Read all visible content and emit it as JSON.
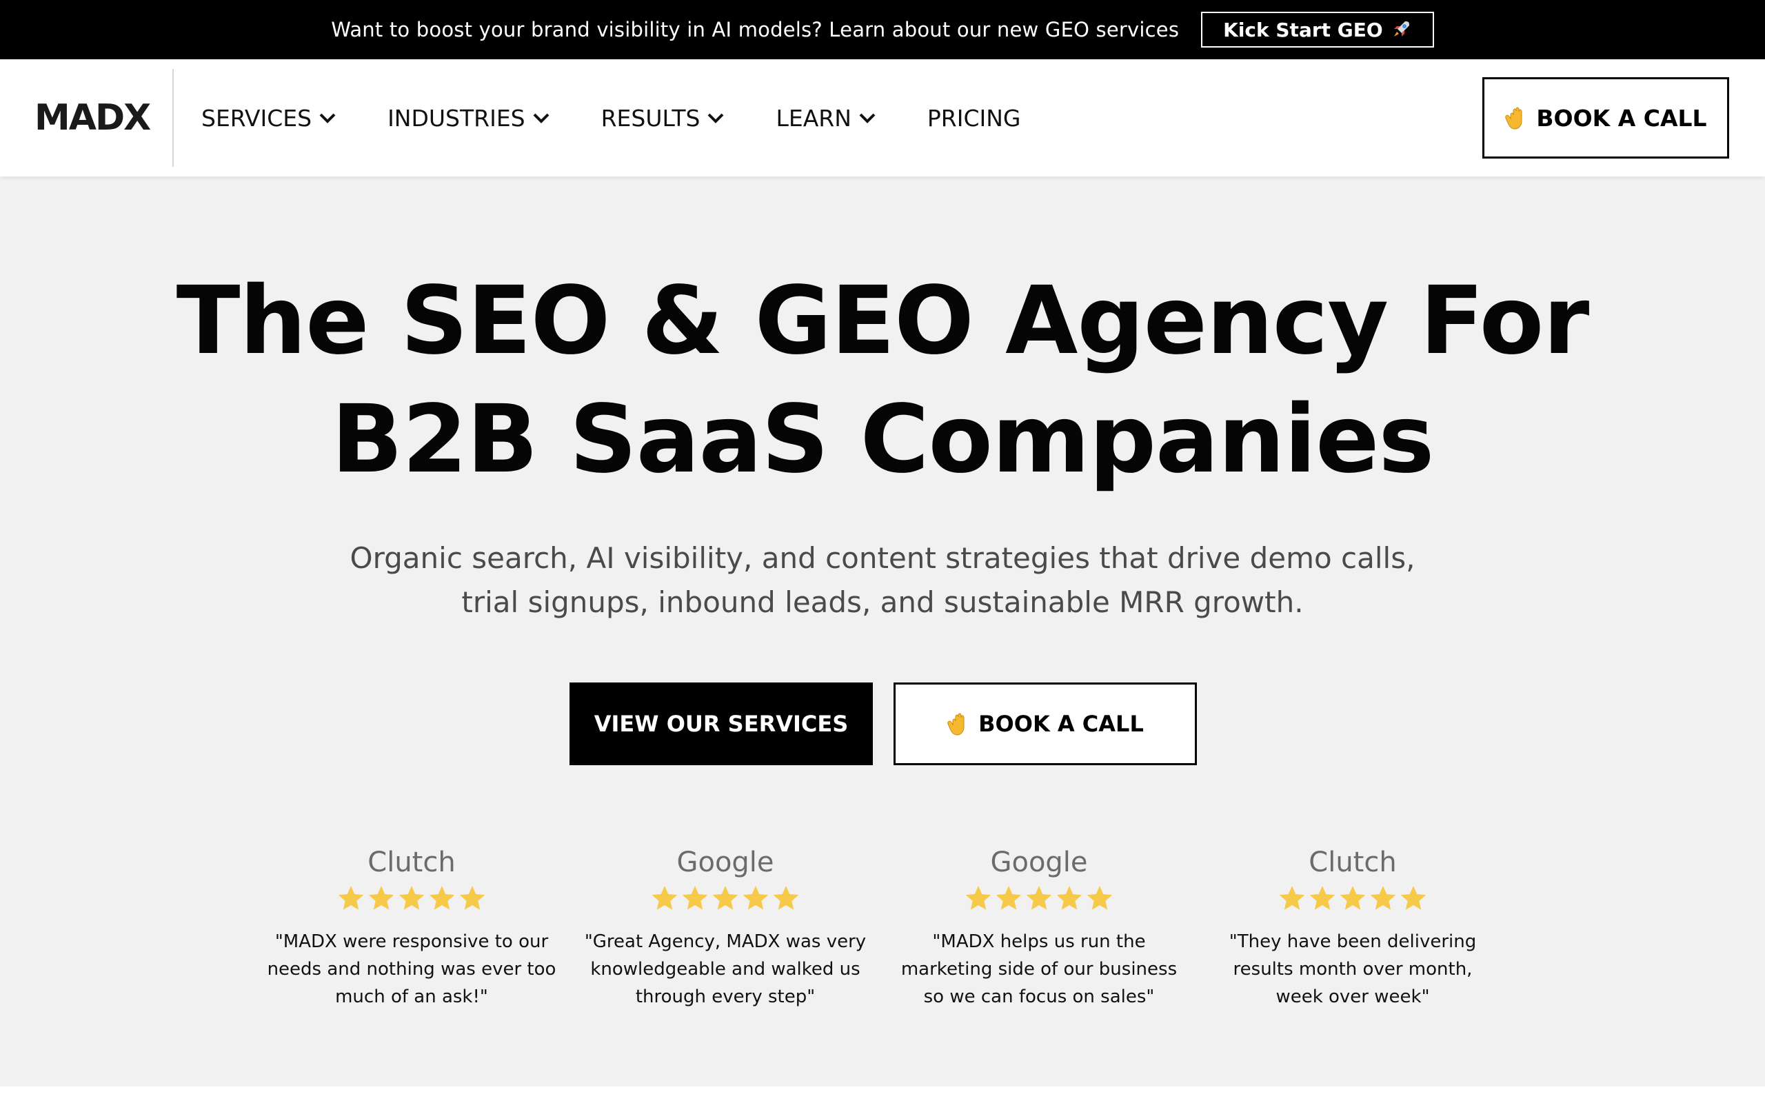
{
  "announcement": {
    "text": "Want to boost your brand visibility in AI models? Learn about our new GEO services",
    "button_label": "Kick Start GEO",
    "button_icon": "rocket-icon"
  },
  "header": {
    "logo": "MADX",
    "nav": [
      {
        "label": "SERVICES",
        "has_dropdown": true
      },
      {
        "label": "INDUSTRIES",
        "has_dropdown": true
      },
      {
        "label": "RESULTS",
        "has_dropdown": true
      },
      {
        "label": "LEARN",
        "has_dropdown": true
      },
      {
        "label": "PRICING",
        "has_dropdown": false
      }
    ],
    "cta_label": "BOOK A CALL",
    "cta_icon": "waving-hand-icon"
  },
  "hero": {
    "title_line1": "The SEO & GEO Agency For",
    "title_line2": "B2B SaaS Companies",
    "subtitle": "Organic search, AI visibility, and content strategies that drive demo calls, trial signups, inbound leads, and sustainable MRR growth.",
    "primary_button": "VIEW OUR SERVICES",
    "secondary_button": "BOOK A CALL"
  },
  "reviews": [
    {
      "source": "Clutch",
      "rating": 5,
      "quote": "\"MADX were responsive to our needs and nothing was ever too much of an ask!\""
    },
    {
      "source": "Google",
      "rating": 5,
      "quote": "\"Great Agency, MADX was very knowledgeable and walked us through every step\""
    },
    {
      "source": "Google",
      "rating": 5,
      "quote": "\"MADX helps us run the marketing side of our business so we can focus on sales\""
    },
    {
      "source": "Clutch",
      "rating": 5,
      "quote": "\"They have been delivering results month over month, week over week\""
    }
  ],
  "colors": {
    "background": "#f1f1f1",
    "announcement_bg": "#000000",
    "star": "#f7c948",
    "text": "#000000"
  }
}
